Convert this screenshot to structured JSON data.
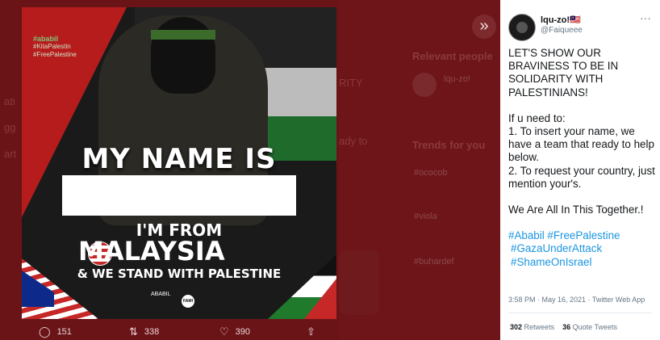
{
  "background": {
    "heading": "Relevant people",
    "trends": "Trends for you",
    "fragments": [
      "ati",
      "gg",
      "art",
      "RITY",
      "ady to"
    ]
  },
  "poster": {
    "tags": [
      "#ababil",
      "#KitaPalestin",
      "#FreePalestine"
    ],
    "line1": "MY NAME IS",
    "line2": "I'M FROM",
    "line3": "MALAYSIA",
    "line4": "& WE STAND WITH PALESTINE",
    "logo_text": "ABABIL",
    "logo_badge": "FAMI"
  },
  "actions": {
    "replies": "151",
    "retweets": "338",
    "likes": "390"
  },
  "tweet": {
    "username": "lqu-zo!🇲🇾",
    "handle": "@Faiqueee",
    "para1": "LET'S SHOW OUR BRAVINESS TO BE IN SOLIDARITY WITH PALESTINIANS!",
    "para2_l1": "If u need to:",
    "para2_l2": "1. To insert your name, we have a team that ready to help below.",
    "para2_l3": "2. To request your country, just mention your's.",
    "para3": "We Are All In This Together.!",
    "hashtags1": "#Ababil #FreePalestine",
    "hashtags2": "#GazaUnderAttack",
    "hashtags3": "#ShameOnIsrael",
    "meta": "3:58 PM · May 16, 2021 · Twitter Web App",
    "retweet_count": "302",
    "retweet_label": "Retweets",
    "quote_count": "36",
    "quote_label": "Quote Tweets"
  }
}
